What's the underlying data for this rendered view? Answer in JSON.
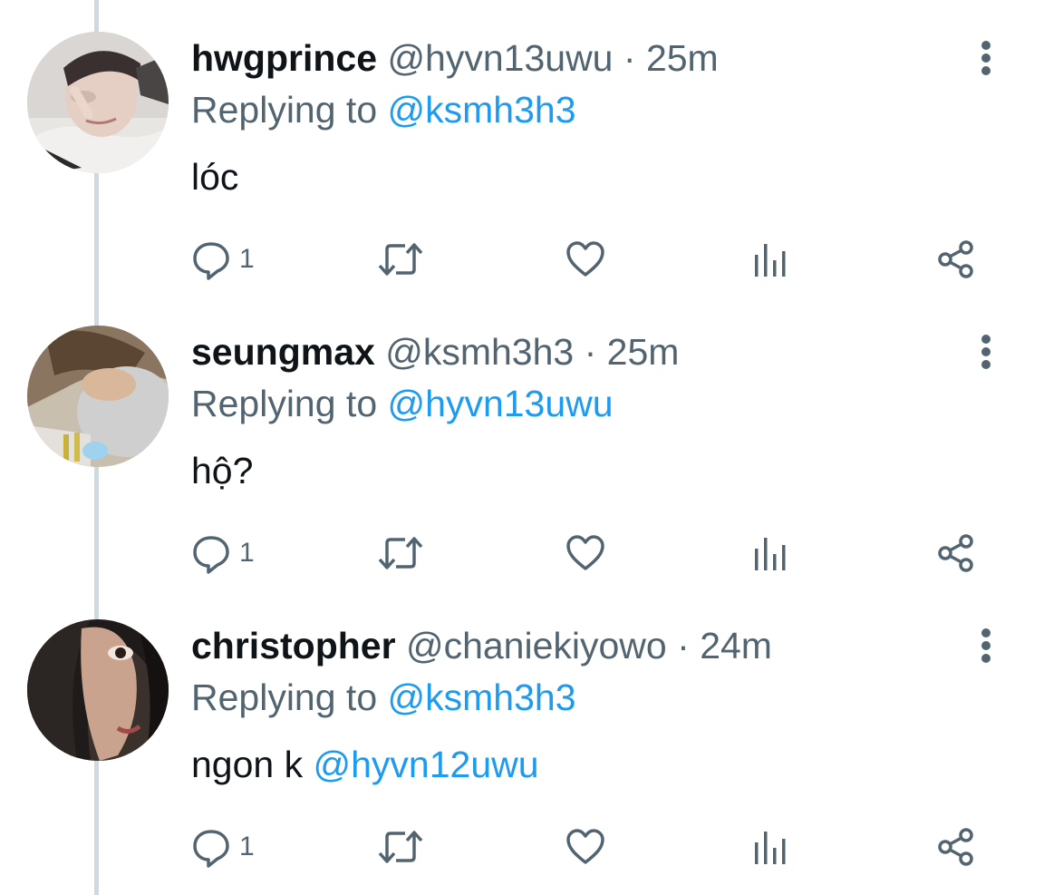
{
  "tweets": [
    {
      "display_name": "hwgprince",
      "handle": "@hyvn13uwu",
      "separator": "·",
      "time": "25m",
      "replying_prefix": "Replying to",
      "replying_to": "@ksmh3h3",
      "text": "lóc",
      "mention": "",
      "reply_count": "1"
    },
    {
      "display_name": "seungmax",
      "handle": "@ksmh3h3",
      "separator": "·",
      "time": "25m",
      "replying_prefix": "Replying to",
      "replying_to": "@hyvn13uwu",
      "text": "hộ?",
      "mention": "",
      "reply_count": "1"
    },
    {
      "display_name": "christopher",
      "handle": "@chaniekiyowo",
      "separator": "·",
      "time": "24m",
      "replying_prefix": "Replying to",
      "replying_to": "@ksmh3h3",
      "text": "ngon k ",
      "mention": "@hyvn12uwu",
      "reply_count": "1"
    }
  ],
  "icons": {
    "reply": "reply-icon",
    "retweet": "retweet-icon",
    "like": "heart-icon",
    "views": "views-icon",
    "share": "share-icon",
    "more": "more-vertical-icon"
  },
  "colors": {
    "text": "#0f1419",
    "secondary": "#536471",
    "accent": "#1d9bf0",
    "thread_line": "#cfd9de"
  }
}
